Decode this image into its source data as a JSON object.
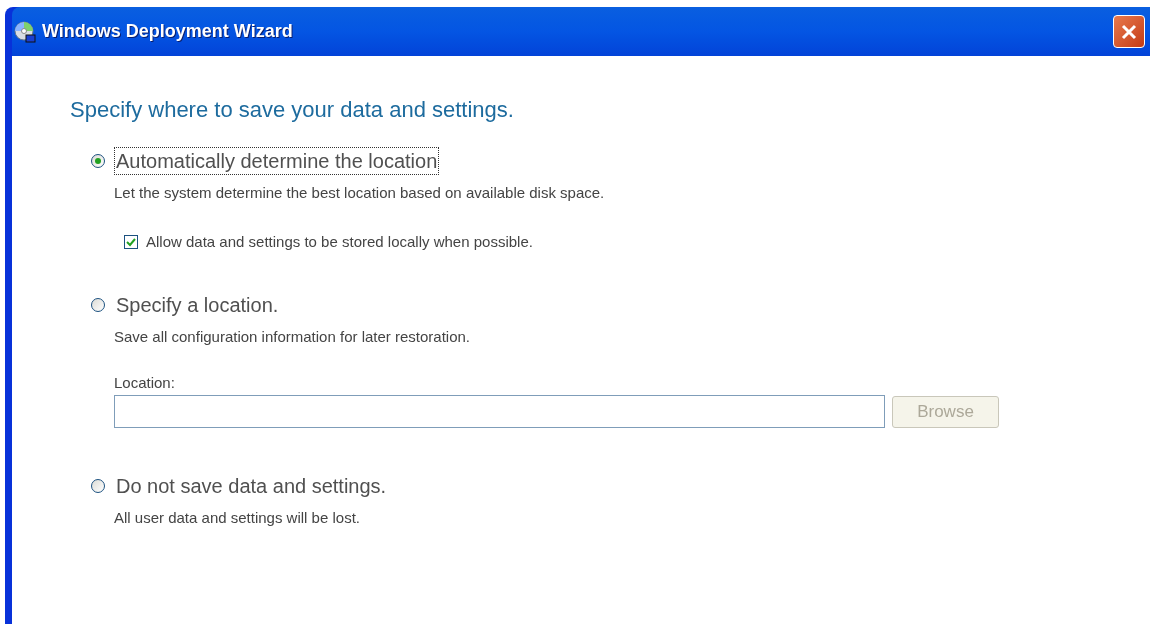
{
  "window": {
    "title": "Windows Deployment Wizard"
  },
  "heading": "Specify where to save your data and settings.",
  "options": [
    {
      "label": "Automatically determine the location",
      "description": "Let the system determine the best location based on available disk space.",
      "selected": true,
      "focused": true,
      "checkbox": {
        "label": "Allow data and settings to be stored locally when possible.",
        "checked": true
      }
    },
    {
      "label": "Specify a location.",
      "description": "Save all configuration information for later restoration.",
      "selected": false,
      "focused": false,
      "location": {
        "label": "Location:",
        "button": "Browse",
        "disabled": true
      }
    },
    {
      "label": "Do not save data and settings.",
      "description": "All user data and settings will be lost.",
      "selected": false,
      "focused": false
    }
  ]
}
